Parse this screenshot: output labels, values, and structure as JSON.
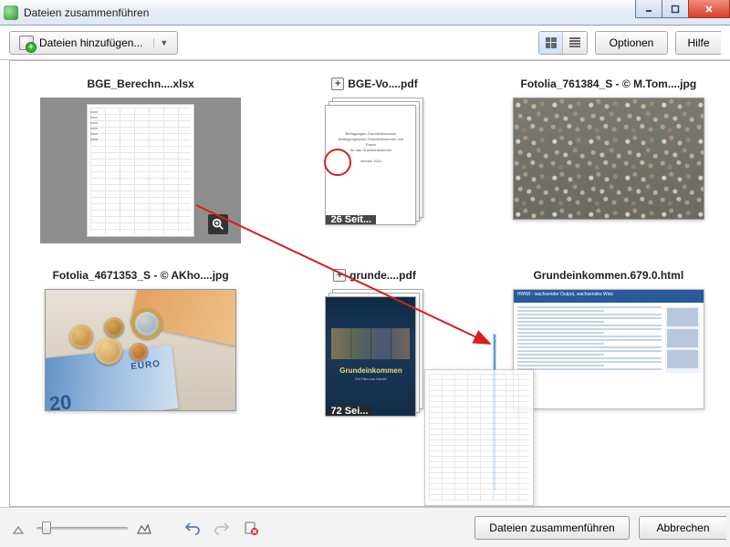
{
  "window": {
    "title": "Dateien zusammenführen"
  },
  "toolbar": {
    "add_files": "Dateien hinzufügen...",
    "options": "Optionen",
    "help": "Hilfe"
  },
  "files": [
    {
      "name": "BGE_Berechn....xlsx",
      "type": "spreadsheet",
      "selected": true
    },
    {
      "name": "BGE-Vo....pdf",
      "type": "pdf",
      "pages_label": "26 Seit...",
      "expandable": true
    },
    {
      "name": "Fotolia_761384_S - © M.Tom....jpg",
      "type": "image-crowd"
    },
    {
      "name": "Fotolia_4671353_S - © AKho....jpg",
      "type": "image-money"
    },
    {
      "name": "grunde....pdf",
      "type": "pdf-cover",
      "pages_label": "72 Sei...",
      "cover_title": "Grundeinkommen",
      "expandable": true
    },
    {
      "name": "Grundeinkommen.679.0.html",
      "type": "html",
      "header_text": "HWWI - wachsender Output, wachsendes Wiss"
    }
  ],
  "money": {
    "note20": "20",
    "euro": "EURO"
  },
  "footer": {
    "combine": "Dateien zusammenführen",
    "cancel": "Abbrechen"
  }
}
